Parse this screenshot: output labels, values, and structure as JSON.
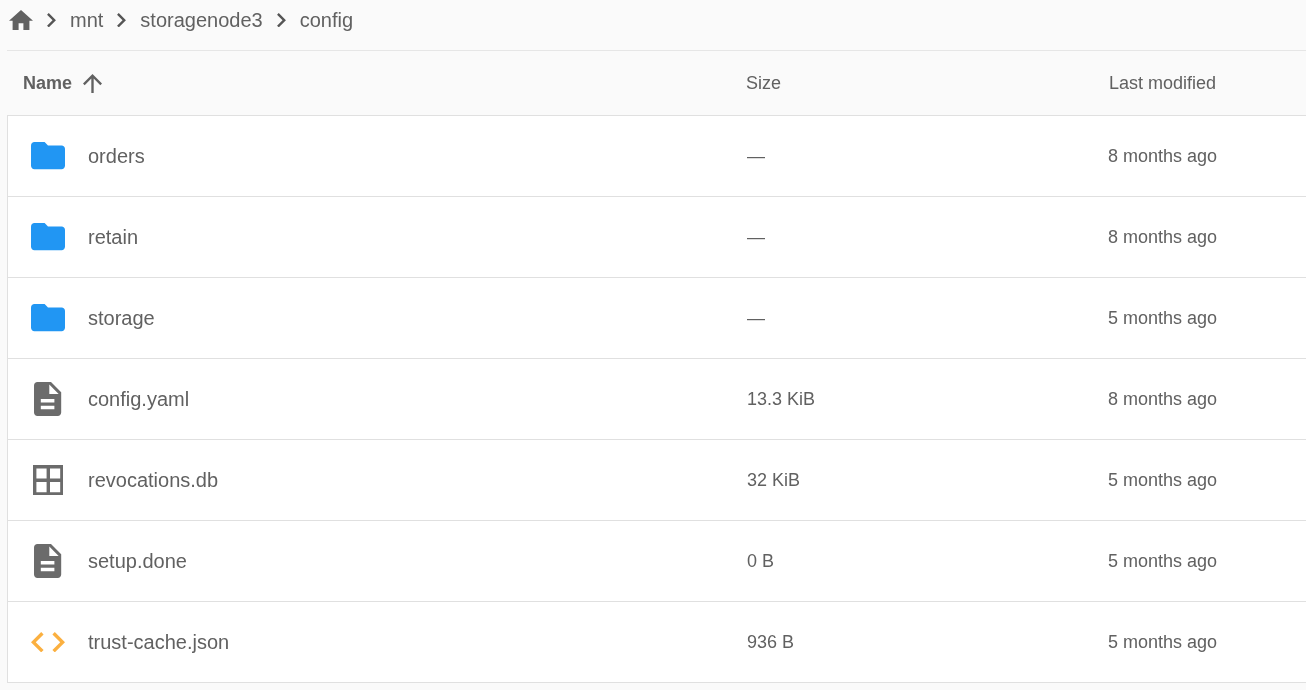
{
  "breadcrumb": {
    "items": [
      {
        "label": "mnt"
      },
      {
        "label": "storagenode3"
      },
      {
        "label": "config"
      }
    ]
  },
  "table": {
    "columns": [
      {
        "label": "Name",
        "sorted": true
      },
      {
        "label": "Size",
        "sorted": false
      },
      {
        "label": "Last modified",
        "sorted": false
      }
    ],
    "rows": [
      {
        "kind": "folder",
        "name": "orders",
        "size": "—",
        "modified": "8 months ago"
      },
      {
        "kind": "folder",
        "name": "retain",
        "size": "—",
        "modified": "8 months ago"
      },
      {
        "kind": "folder",
        "name": "storage",
        "size": "—",
        "modified": "5 months ago"
      },
      {
        "kind": "text",
        "name": "config.yaml",
        "size": "13.3 KiB",
        "modified": "8 months ago"
      },
      {
        "kind": "database",
        "name": "revocations.db",
        "size": "32 KiB",
        "modified": "5 months ago"
      },
      {
        "kind": "text",
        "name": "setup.done",
        "size": "0 B",
        "modified": "5 months ago"
      },
      {
        "kind": "code",
        "name": "trust-cache.json",
        "size": "936 B",
        "modified": "5 months ago"
      }
    ]
  }
}
